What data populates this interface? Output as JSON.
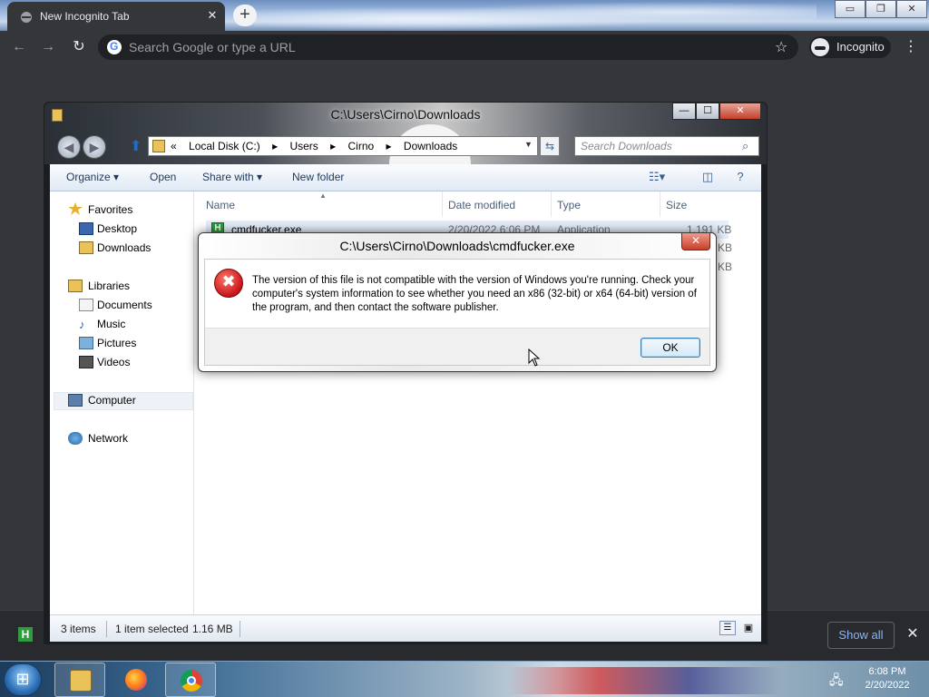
{
  "chrome": {
    "tab_title": "New Incognito Tab",
    "tab_close": "✕",
    "new_tab": "+",
    "window_controls": [
      "▭",
      "❐",
      "✕"
    ],
    "omnibox_placeholder": "Search Google or type a URL",
    "incognito_label": "Incognito",
    "back_icon": "←",
    "forward_icon": "→",
    "reload_icon": "↻",
    "star_icon": "☆",
    "menu_icon": "⋮"
  },
  "downloads_bar": {
    "file_icon_letter": "H",
    "show_all": "Show all",
    "close": "✕"
  },
  "explorer": {
    "title": "C:\\Users\\Cirno\\Downloads",
    "controls": {
      "minimize": "—",
      "maximize": "☐",
      "close": "✕"
    },
    "address": {
      "prefix": "«",
      "crumbs": [
        "Local Disk (C:)",
        "Users",
        "Cirno",
        "Downloads"
      ],
      "separator": "▸"
    },
    "search_placeholder": "Search Downloads",
    "commands": {
      "organize": "Organize ▾",
      "open": "Open",
      "share_with": "Share with ▾",
      "new_folder": "New folder"
    },
    "nav": {
      "favorites": "Favorites",
      "desktop": "Desktop",
      "downloads": "Downloads",
      "libraries": "Libraries",
      "documents": "Documents",
      "music": "Music",
      "pictures": "Pictures",
      "videos": "Videos",
      "computer": "Computer",
      "network": "Network"
    },
    "columns": {
      "name": "Name",
      "date_modified": "Date modified",
      "type": "Type",
      "size": "Size"
    },
    "files": [
      {
        "name": "cmdfucker.exe",
        "date": "2/20/2022 6:06 PM",
        "type": "Application",
        "size": "1,191 KB"
      },
      {
        "name": "",
        "date": "",
        "type": "",
        "size": "KB"
      },
      {
        "name": "",
        "date": "",
        "type": "",
        "size": "KB"
      }
    ],
    "status": {
      "count": "3 items",
      "selected": "1 item selected",
      "size": "1.16 MB"
    }
  },
  "dialog": {
    "title": "C:\\Users\\Cirno\\Downloads\\cmdfucker.exe",
    "close": "✕",
    "message": "The version of this file is not compatible with the version of Windows you're running. Check your computer's system information to see whether you need an x86 (32-bit) or x64 (64-bit) version of the program, and then contact the software publisher.",
    "ok": "OK"
  },
  "taskbar": {
    "time": "6:08 PM",
    "date": "2/20/2022",
    "apps": [
      "file-explorer",
      "firefox",
      "chrome"
    ]
  },
  "colors": {
    "chrome_bg": "#35363a",
    "link_blue": "#8ab4f8",
    "error_red": "#c8141a",
    "ok_border": "#3c7fb1"
  }
}
